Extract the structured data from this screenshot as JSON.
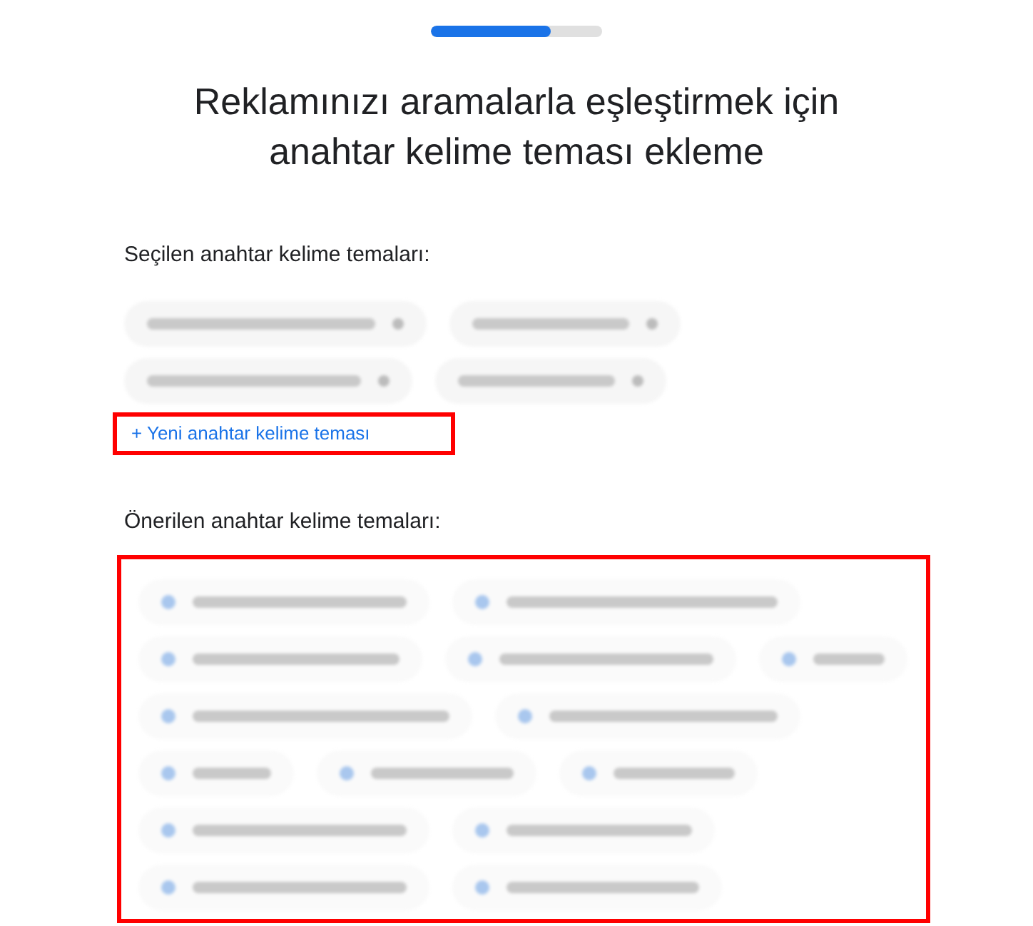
{
  "progress": {
    "level": 0.7
  },
  "title": "Reklamınızı aramalarla eşleştirmek için anahtar kelime teması ekleme",
  "selected_themes": {
    "label": "Seçilen anahtar kelime temaları:",
    "chips": [
      {
        "kind": "blurred"
      },
      {
        "kind": "blurred"
      },
      {
        "kind": "blurred"
      },
      {
        "kind": "blurred"
      }
    ],
    "add_link": "+ Yeni anahtar kelime teması",
    "highlighted": true
  },
  "suggested_themes": {
    "label": "Önerilen anahtar kelime temaları:",
    "highlighted": true,
    "chips": [
      {
        "kind": "blurred"
      },
      {
        "kind": "blurred"
      },
      {
        "kind": "blurred"
      },
      {
        "kind": "blurred"
      },
      {
        "kind": "blurred"
      },
      {
        "kind": "blurred"
      },
      {
        "kind": "blurred"
      },
      {
        "kind": "blurred"
      },
      {
        "kind": "blurred"
      },
      {
        "kind": "blurred"
      },
      {
        "kind": "blurred"
      },
      {
        "kind": "blurred"
      },
      {
        "kind": "blurred"
      },
      {
        "kind": "blurred"
      }
    ]
  }
}
